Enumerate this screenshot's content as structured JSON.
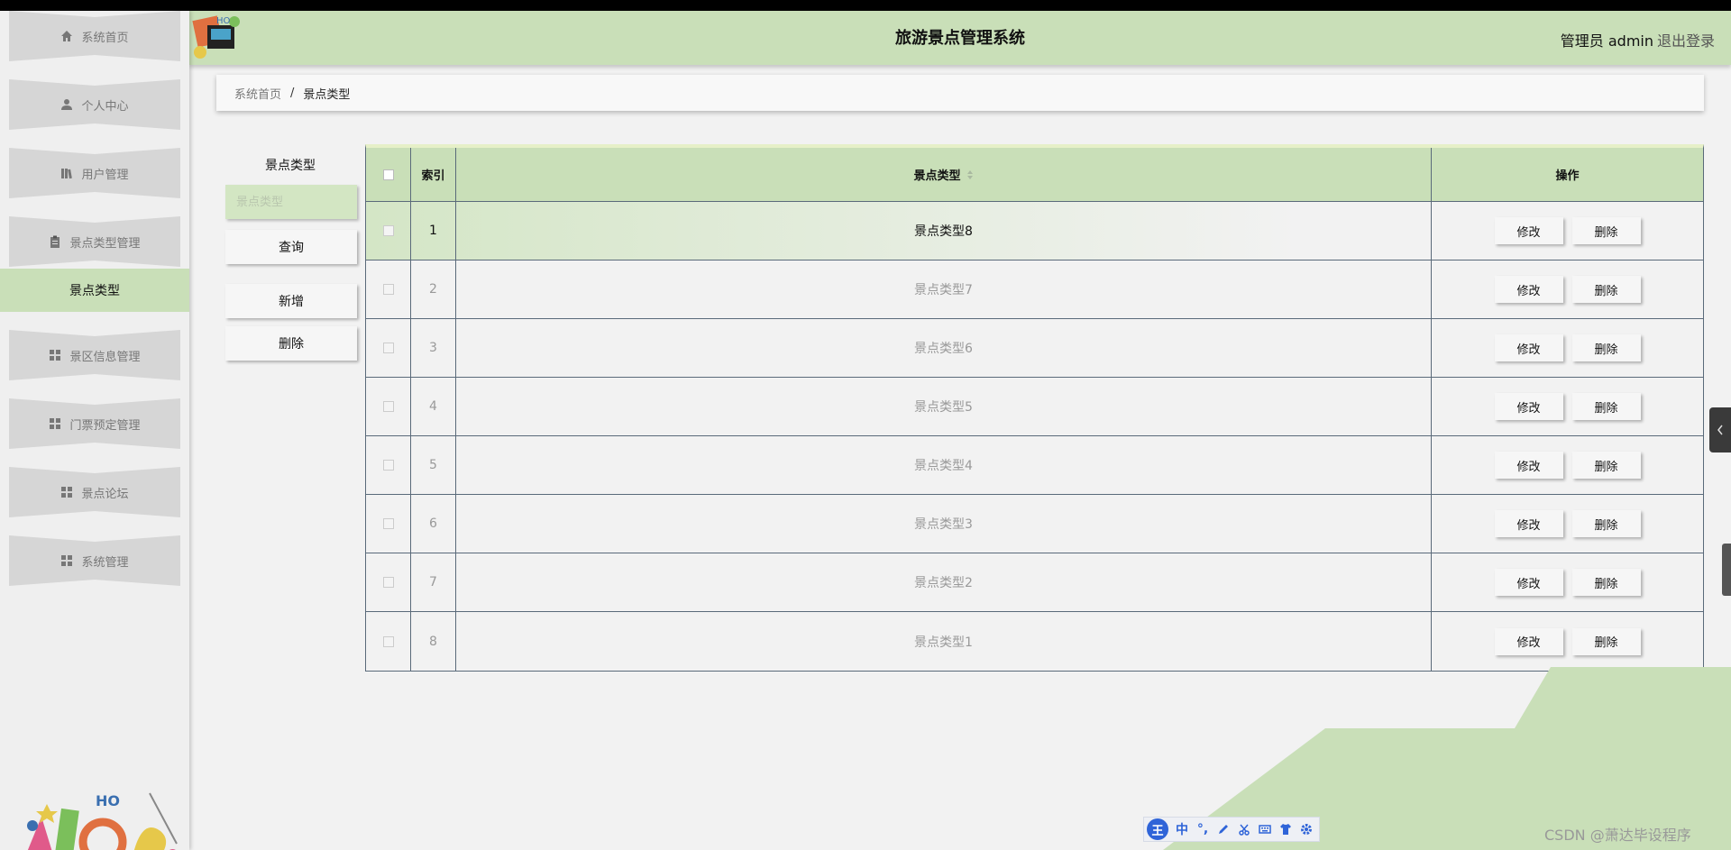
{
  "header": {
    "title": "旅游景点管理系统",
    "user": "管理员 admin",
    "logout": "退出登录"
  },
  "sidebar": {
    "items": [
      {
        "label": "系统首页",
        "icon": "home-icon"
      },
      {
        "label": "个人中心",
        "icon": "user-icon"
      },
      {
        "label": "用户管理",
        "icon": "library-icon"
      },
      {
        "label": "景点类型管理",
        "icon": "clipboard-icon"
      },
      {
        "label": "景区信息管理",
        "icon": "grid-icon"
      },
      {
        "label": "门票预定管理",
        "icon": "grid-icon"
      },
      {
        "label": "景点论坛",
        "icon": "grid-icon"
      },
      {
        "label": "系统管理",
        "icon": "grid-icon"
      }
    ],
    "active_sub": "景点类型"
  },
  "breadcrumb": {
    "home": "系统首页",
    "separator": "/",
    "current": "景点类型"
  },
  "search": {
    "label": "景点类型",
    "placeholder": "景点类型",
    "query_button": "查询",
    "add_button": "新增",
    "delete_button": "删除"
  },
  "table": {
    "headers": {
      "index": "索引",
      "type": "景点类型",
      "ops": "操作"
    },
    "edit_label": "修改",
    "delete_label": "删除",
    "rows": [
      {
        "index": "1",
        "type": "景点类型8"
      },
      {
        "index": "2",
        "type": "景点类型7"
      },
      {
        "index": "3",
        "type": "景点类型6"
      },
      {
        "index": "4",
        "type": "景点类型5"
      },
      {
        "index": "5",
        "type": "景点类型4"
      },
      {
        "index": "6",
        "type": "景点类型3"
      },
      {
        "index": "7",
        "type": "景点类型2"
      },
      {
        "index": "8",
        "type": "景点类型1"
      }
    ]
  },
  "ime": {
    "logo": "王",
    "mode": "中",
    "punct": "°,"
  },
  "watermark": "CSDN @萧达毕设程序",
  "colors": {
    "accent": "#c9dfb8",
    "input": "#d3e6c3",
    "ime": "#2f64d8"
  }
}
